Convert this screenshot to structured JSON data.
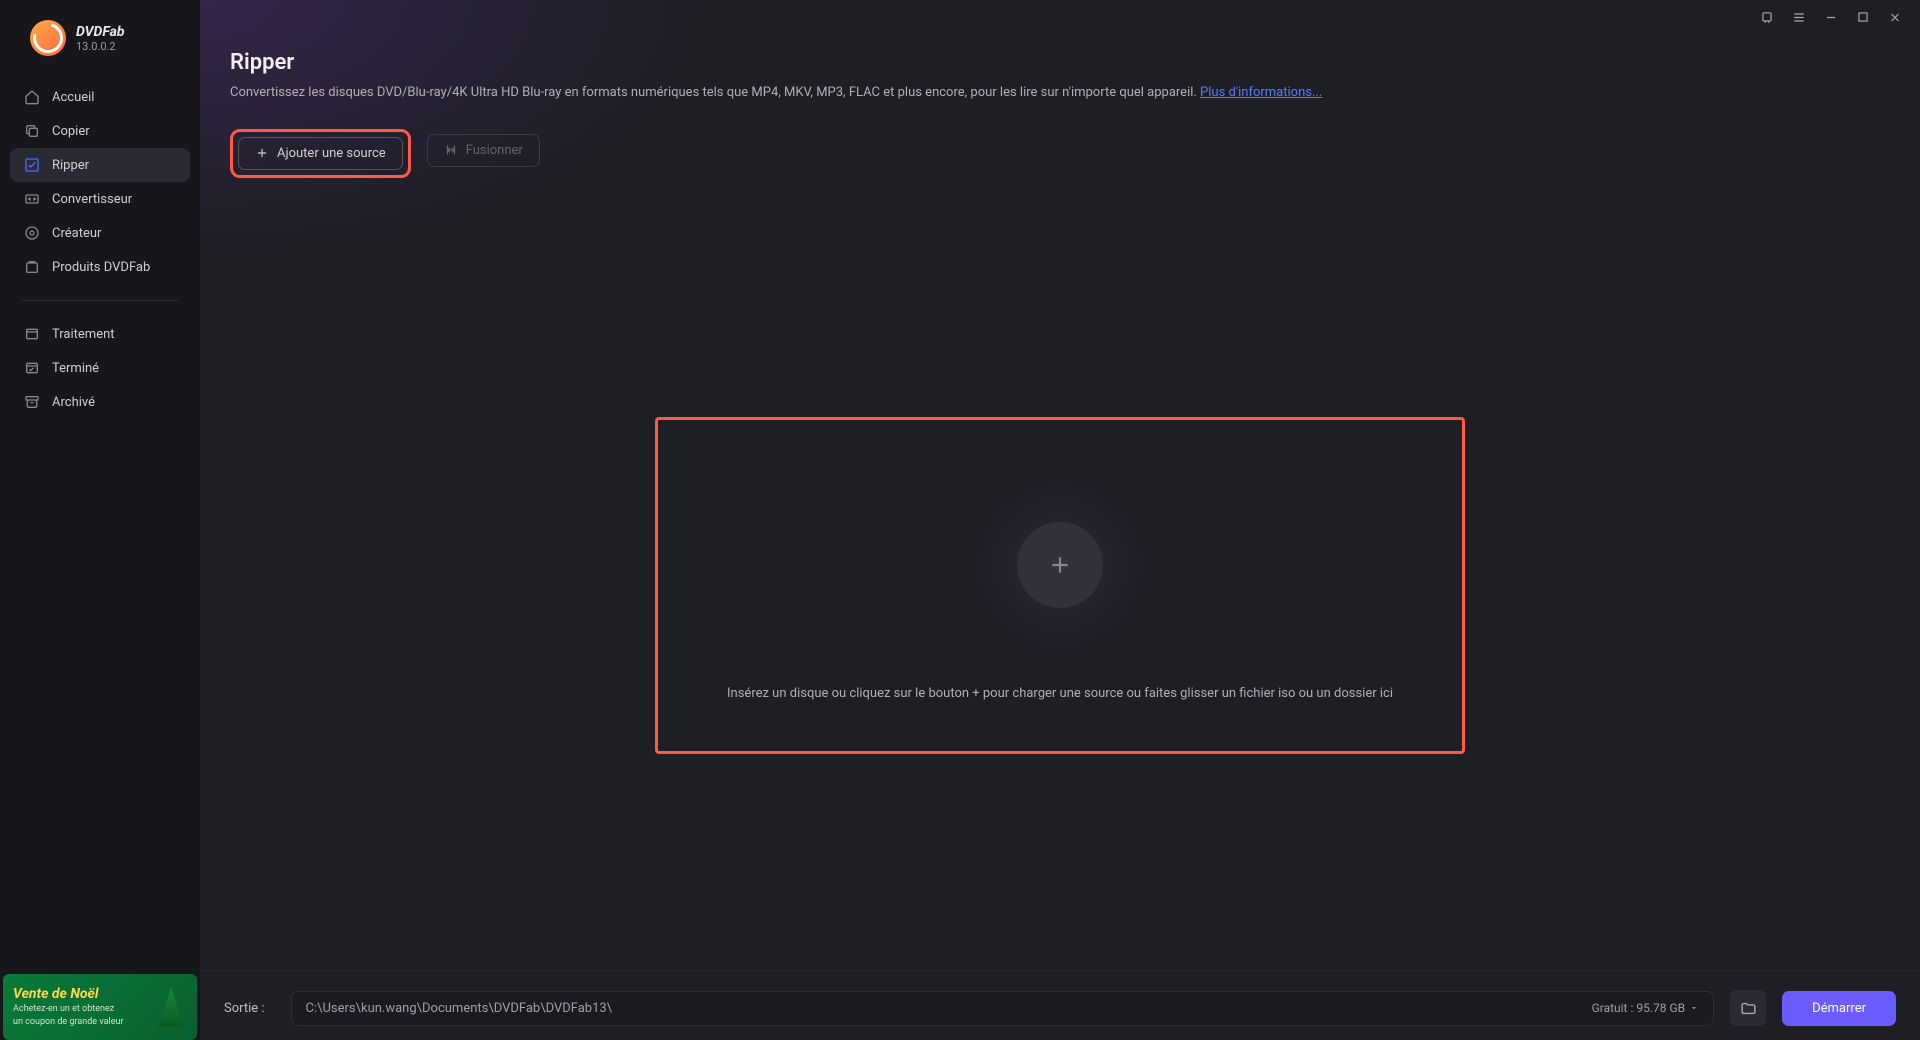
{
  "app": {
    "name": "DVDFab",
    "version": "13.0.0.2"
  },
  "sidebar": {
    "items": [
      {
        "label": "Accueil",
        "icon": "home-icon"
      },
      {
        "label": "Copier",
        "icon": "copy-icon"
      },
      {
        "label": "Ripper",
        "icon": "ripper-icon"
      },
      {
        "label": "Convertisseur",
        "icon": "converter-icon"
      },
      {
        "label": "Créateur",
        "icon": "creator-icon"
      },
      {
        "label": "Produits DVDFab",
        "icon": "products-icon"
      }
    ],
    "tasks": [
      {
        "label": "Traitement",
        "icon": "processing-icon"
      },
      {
        "label": "Terminé",
        "icon": "done-icon"
      },
      {
        "label": "Archivé",
        "icon": "archive-icon"
      }
    ]
  },
  "promo": {
    "title": "Vente de Noël",
    "line1": "Achetez-en un et obtenez",
    "line2": "un coupon de grande valeur"
  },
  "header": {
    "title": "Ripper",
    "description": "Convertissez les disques DVD/Blu-ray/4K Ultra HD Blu-ray en formats numériques tels que MP4, MKV, MP3, FLAC et plus encore, pour les lire sur n'importe quel appareil. ",
    "more_link": "Plus d'informations..."
  },
  "actions": {
    "add_source": "Ajouter une source",
    "merge": "Fusionner"
  },
  "drop": {
    "hint": "Insérez un disque ou cliquez sur le bouton +  pour charger une source ou faites glisser un fichier iso ou un dossier ici"
  },
  "footer": {
    "output_label": "Sortie :",
    "output_path": "C:\\Users\\kun.wang\\Documents\\DVDFab\\DVDFab13\\",
    "free_space": "Gratuit : 95.78 GB",
    "start": "Démarrer"
  }
}
